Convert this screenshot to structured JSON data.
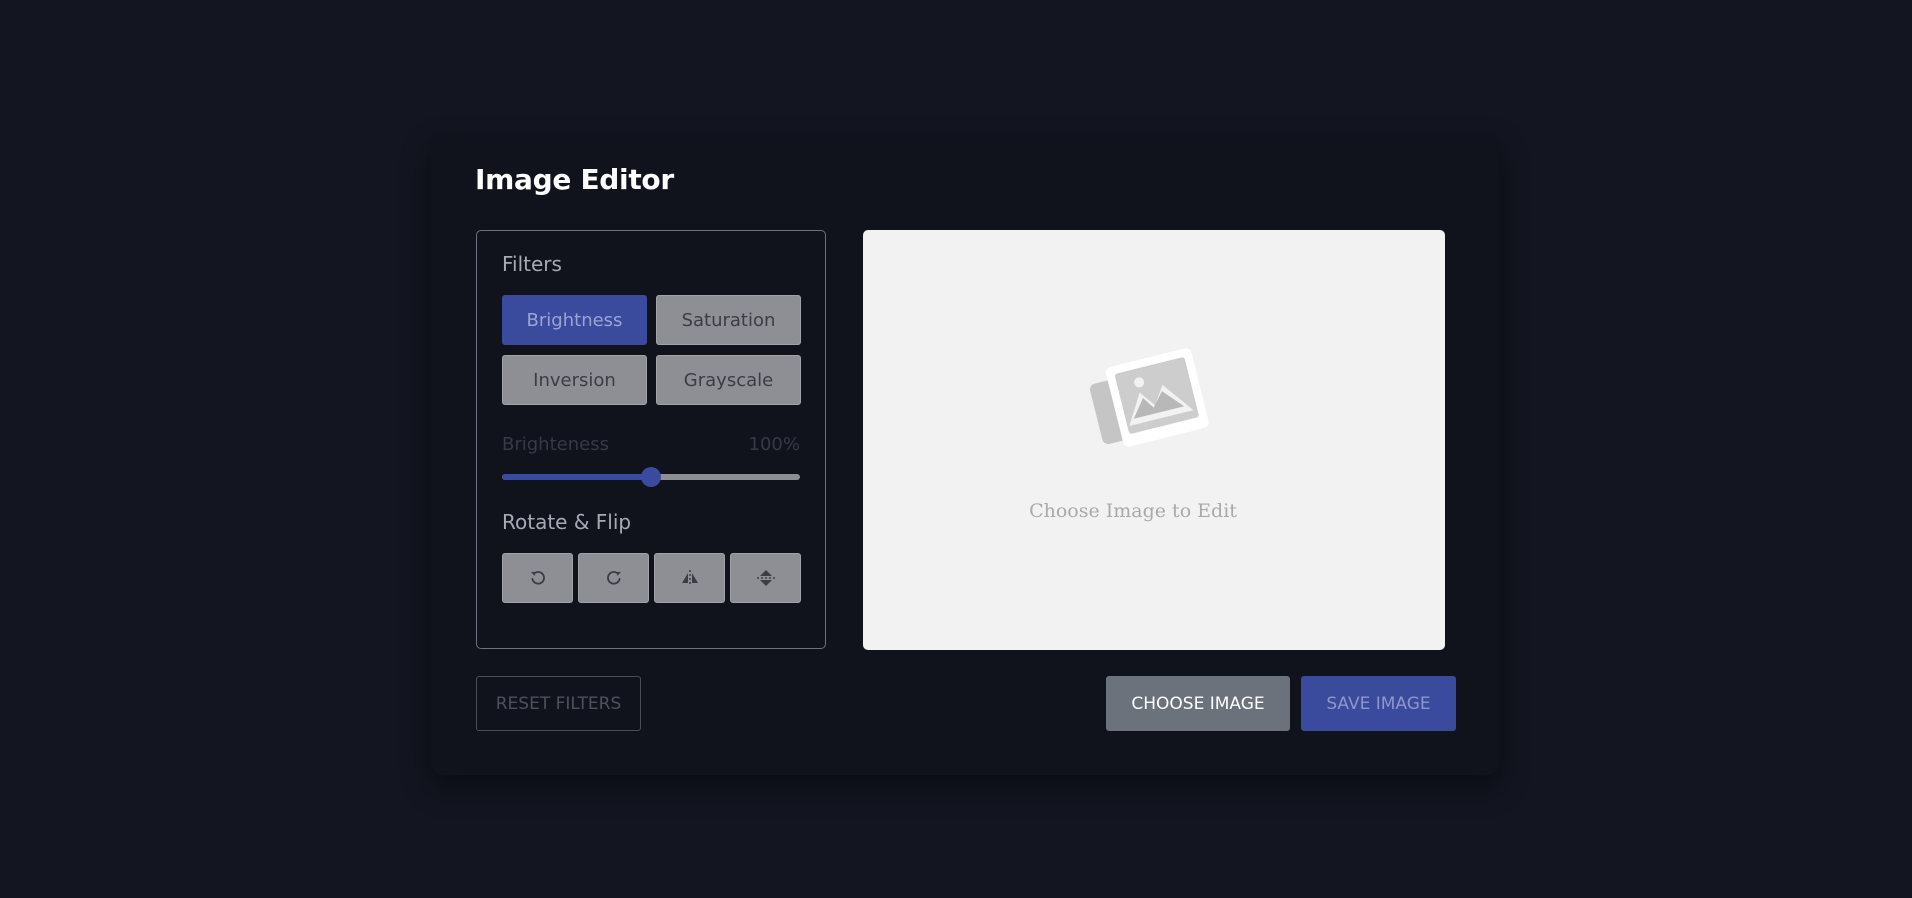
{
  "app": {
    "title": "Image Editor"
  },
  "filters": {
    "heading": "Filters",
    "options": [
      {
        "label": "Brightness",
        "active": true
      },
      {
        "label": "Saturation",
        "active": false
      },
      {
        "label": "Inversion",
        "active": false
      },
      {
        "label": "Grayscale",
        "active": false
      }
    ],
    "slider": {
      "label": "Brighteness",
      "value_text": "100%",
      "value_fraction": 0.5
    }
  },
  "rotate_flip": {
    "heading": "Rotate & Flip",
    "buttons": [
      {
        "icon": "rotate-left-icon"
      },
      {
        "icon": "rotate-right-icon"
      },
      {
        "icon": "flip-horizontal-icon"
      },
      {
        "icon": "flip-vertical-icon"
      }
    ]
  },
  "preview": {
    "icon": "image-placeholder-icon",
    "placeholder_text": "Choose Image to Edit"
  },
  "actions": {
    "reset_label": "RESET FILTERS",
    "choose_label": "CHOOSE IMAGE",
    "save_label": "SAVE IMAGE"
  },
  "colors": {
    "background": "#131520",
    "card": "#11131c",
    "accent": "#3a4a9d",
    "button_gray": "#8e8f95",
    "choose_button": "#6b727c",
    "preview_bg": "#f2f2f2"
  }
}
